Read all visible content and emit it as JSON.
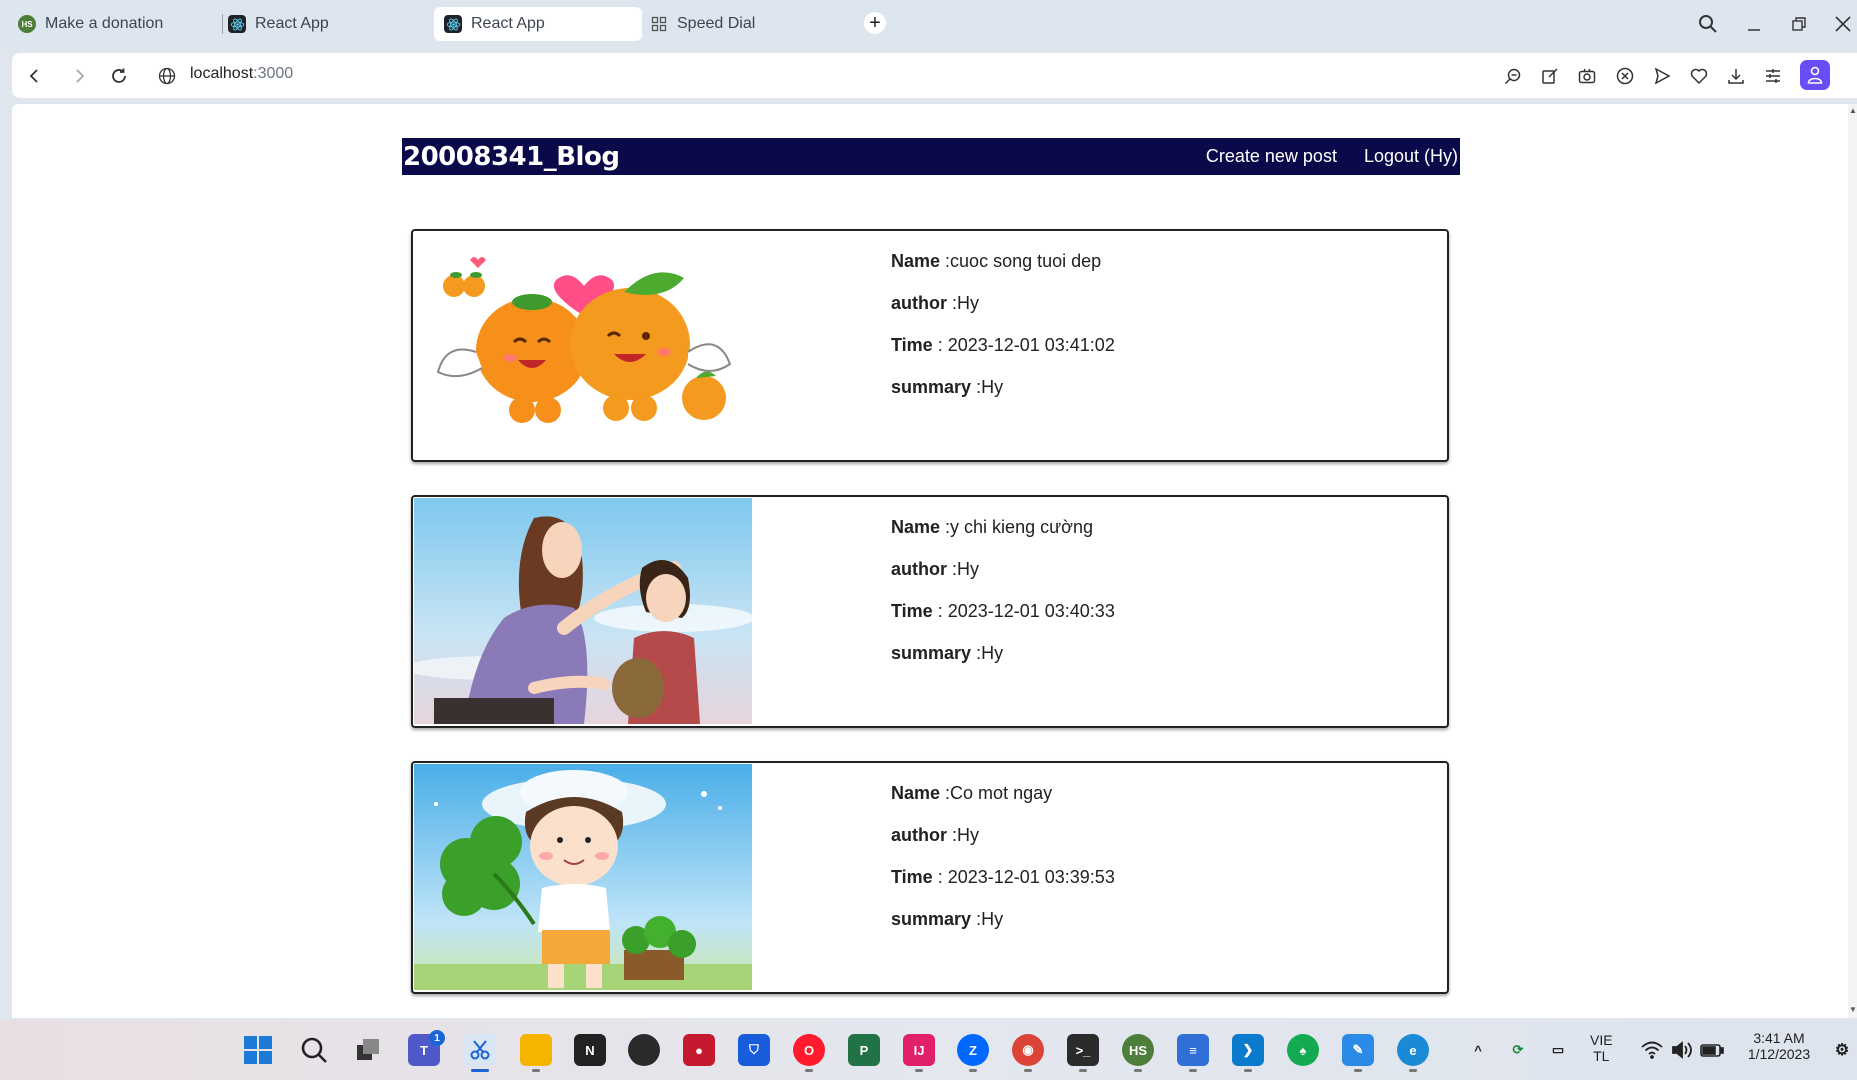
{
  "browser": {
    "tabs": [
      {
        "title": "Make a donation",
        "favicon": "hs-icon"
      },
      {
        "title": "React App",
        "favicon": "react-icon"
      },
      {
        "title": "React App",
        "favicon": "react-icon",
        "active": true
      },
      {
        "title": "Speed Dial",
        "favicon": "grid-icon"
      }
    ],
    "new_tab_label": "+",
    "address": {
      "host": "localhost",
      "port": ":3000"
    }
  },
  "app": {
    "brand": "20008341_Blog",
    "nav": {
      "create": "Create new post",
      "logout": "Logout (Hy)"
    },
    "labels": {
      "name": "Name",
      "author": "author",
      "time": "Time",
      "summary": "summary"
    },
    "posts": [
      {
        "name": ":cuoc song tuoi dep",
        "author": ":Hy",
        "time": " : 2023-12-01 03:41:02",
        "summary": ":Hy",
        "image": "oranges-illustration"
      },
      {
        "name": ":y chi kieng cường",
        "author": ":Hy",
        "time": " : 2023-12-01 03:40:33",
        "summary": ":Hy",
        "image": "mother-child-illustration"
      },
      {
        "name": ":Co mot ngay",
        "author": ":Hy",
        "time": " : 2023-12-01 03:39:53",
        "summary": ":Hy",
        "image": "boy-clover-illustration"
      }
    ]
  },
  "taskbar": {
    "teams_badge": "1",
    "lang_line1": "VIE",
    "lang_line2": "TL",
    "clock_time": "3:41 AM",
    "clock_date": "1/12/2023"
  },
  "colors": {
    "header_bg": "#0a0a4a",
    "accent": "#6a4df5"
  }
}
